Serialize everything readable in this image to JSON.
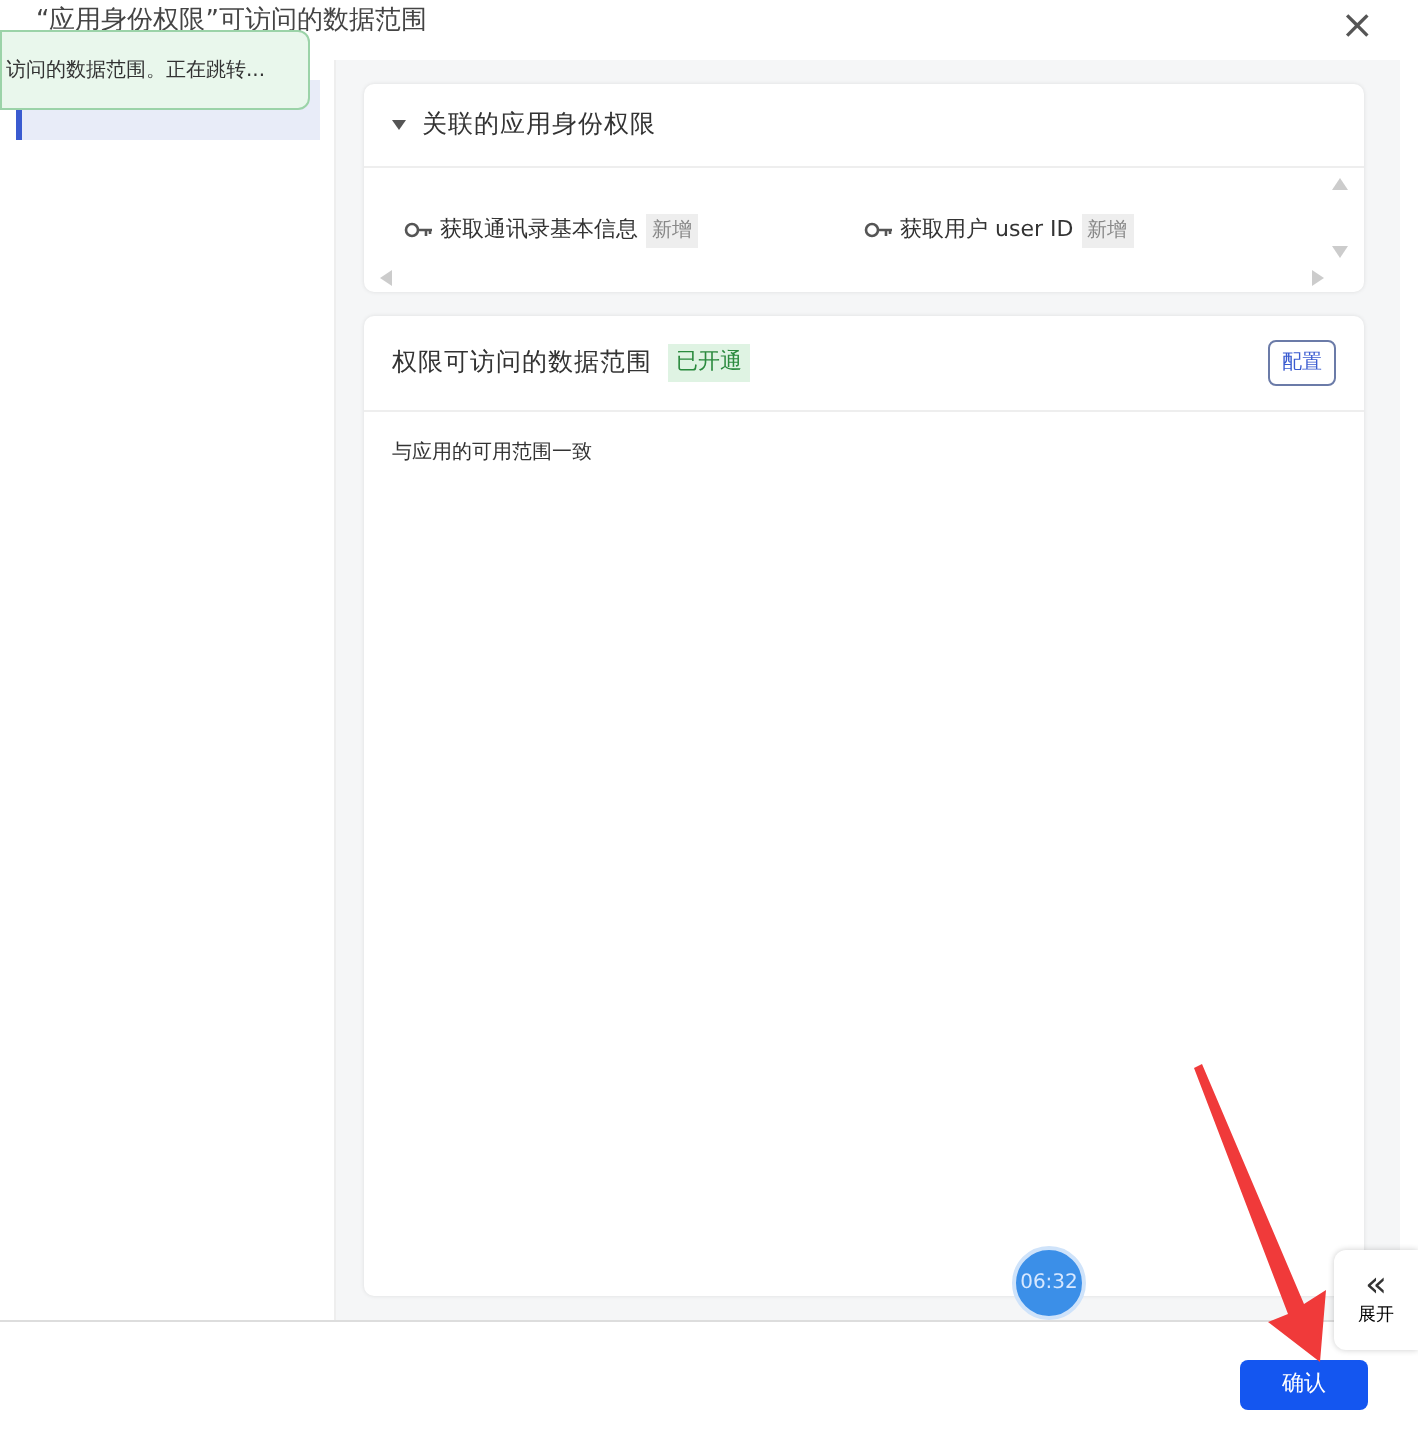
{
  "window": {
    "title": "“应用身份权限”可访问的数据范围",
    "close": "×"
  },
  "toast": {
    "text": "访问的数据范围。正在跳转..."
  },
  "related_permissions": {
    "title": "关联的应用身份权限",
    "expanded": true,
    "items": [
      {
        "label": "获取通讯录基本信息",
        "tag": "新增"
      },
      {
        "label": "获取用户 user ID",
        "tag": "新增"
      }
    ]
  },
  "data_scope": {
    "title": "权限可访问的数据范围",
    "status": "已开通",
    "configure": "配置",
    "description": "与应用的可用范围一致"
  },
  "timer": "06:32",
  "side_tab": {
    "arrow": "«",
    "label": "展开"
  },
  "footer": {
    "confirm": "确认"
  }
}
